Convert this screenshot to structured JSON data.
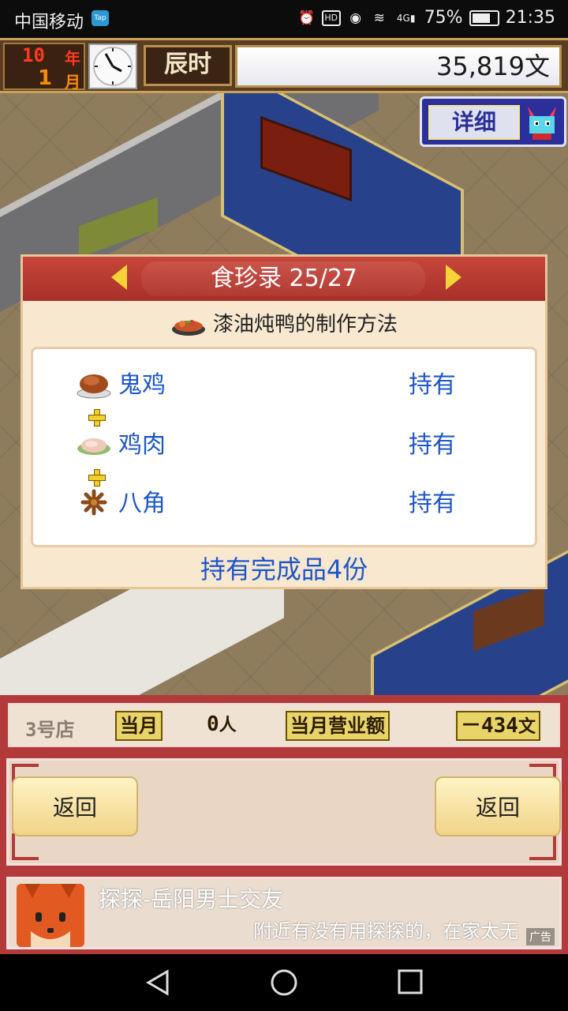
{
  "status_bar": {
    "carrier": "中国移动",
    "tap_badge": "Tap",
    "hd_label": "HD",
    "network_label": "4G",
    "battery": "75%",
    "time": "21:35",
    "icons": [
      "alarm-icon",
      "hd-icon",
      "eye-icon",
      "wifi-icon",
      "signal-icon",
      "battery-icon"
    ]
  },
  "top_bar": {
    "year_value": "10",
    "year_unit": "年",
    "month_value": "1",
    "month_unit": "月",
    "time_period": "辰时",
    "money": "35,819文",
    "detail_button": "详细"
  },
  "recipe_dialog": {
    "title": "食珍录 25/27",
    "subtitle": "漆油炖鸭的制作方法",
    "ingredients": [
      {
        "name": "鬼鸡",
        "status": "持有",
        "icon": "roast-chicken-icon"
      },
      {
        "name": "鸡肉",
        "status": "持有",
        "icon": "chicken-meat-icon"
      },
      {
        "name": "八角",
        "status": "持有",
        "icon": "star-anise-icon"
      }
    ],
    "footer": "持有完成品4份"
  },
  "info_bar": {
    "store": "3号店",
    "month_label": "当月",
    "visitors": "0",
    "visitor_unit": "人",
    "revenue_label": "当月营业额",
    "revenue": "－434",
    "revenue_unit": "文"
  },
  "buttons": {
    "return_left": "返回",
    "return_right": "返回"
  },
  "ad": {
    "title": "探探-岳阳男士交友",
    "description": "附近有没有用探探的，在家太无",
    "label": "广告"
  },
  "colors": {
    "accent_red": "#b33a3a",
    "ingredient_blue": "#1e56c8",
    "dialog_bg": "#f7e8cf"
  }
}
